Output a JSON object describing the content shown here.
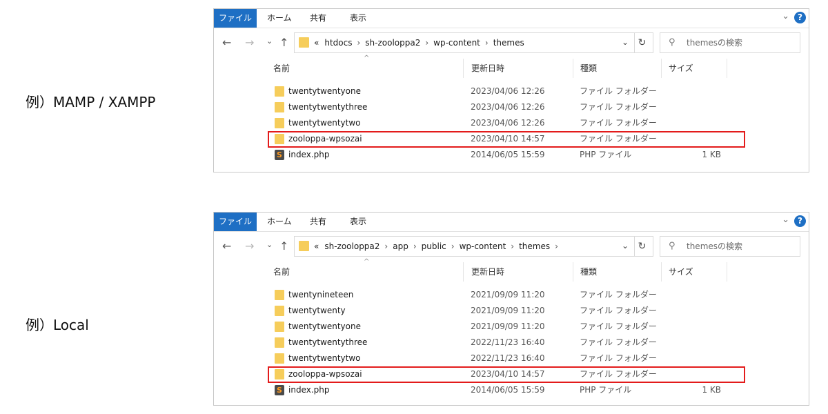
{
  "captions": [
    "例）MAMP / XAMPP",
    "例）Local"
  ],
  "ribbon_tabs": [
    "ファイル",
    "ホーム",
    "共有",
    "表示"
  ],
  "icons": {
    "back": "←",
    "forward": "→",
    "recent": "⌄",
    "up": "↑",
    "refresh": "↻",
    "search": "⚲",
    "dropdown": "⌄",
    "help": "?",
    "collapse": "⌄"
  },
  "columns": {
    "name": "名前",
    "date": "更新日時",
    "type": "種類",
    "size": "サイズ"
  },
  "search_placeholder": "themesの検索",
  "windows": [
    {
      "crumbs": [
        "«",
        "htdocs",
        "sh-zooloppa2",
        "wp-content",
        "themes"
      ],
      "rows": [
        {
          "name": "twentytwentyone",
          "date": "2023/04/06 12:26",
          "type": "ファイル フォルダー",
          "size": "",
          "icon": "folder"
        },
        {
          "name": "twentytwentythree",
          "date": "2023/04/06 12:26",
          "type": "ファイル フォルダー",
          "size": "",
          "icon": "folder"
        },
        {
          "name": "twentytwentytwo",
          "date": "2023/04/06 12:26",
          "type": "ファイル フォルダー",
          "size": "",
          "icon": "folder"
        },
        {
          "name": "zooloppa-wpsozai",
          "date": "2023/04/10 14:57",
          "type": "ファイル フォルダー",
          "size": "",
          "icon": "folder",
          "highlight": true
        },
        {
          "name": "index.php",
          "date": "2014/06/05 15:59",
          "type": "PHP ファイル",
          "size": "1 KB",
          "icon": "php"
        }
      ]
    },
    {
      "crumbs": [
        "«",
        "sh-zooloppa2",
        "app",
        "public",
        "wp-content",
        "themes",
        ""
      ],
      "rows": [
        {
          "name": "twentynineteen",
          "date": "2021/09/09 11:20",
          "type": "ファイル フォルダー",
          "size": "",
          "icon": "folder"
        },
        {
          "name": "twentytwenty",
          "date": "2021/09/09 11:20",
          "type": "ファイル フォルダー",
          "size": "",
          "icon": "folder"
        },
        {
          "name": "twentytwentyone",
          "date": "2021/09/09 11:20",
          "type": "ファイル フォルダー",
          "size": "",
          "icon": "folder"
        },
        {
          "name": "twentytwentythree",
          "date": "2022/11/23 16:40",
          "type": "ファイル フォルダー",
          "size": "",
          "icon": "folder"
        },
        {
          "name": "twentytwentytwo",
          "date": "2022/11/23 16:40",
          "type": "ファイル フォルダー",
          "size": "",
          "icon": "folder"
        },
        {
          "name": "zooloppa-wpsozai",
          "date": "2023/04/10 14:57",
          "type": "ファイル フォルダー",
          "size": "",
          "icon": "folder",
          "highlight": true
        },
        {
          "name": "index.php",
          "date": "2014/06/05 15:59",
          "type": "PHP ファイル",
          "size": "1 KB",
          "icon": "php"
        }
      ]
    }
  ],
  "colors": {
    "ribbon_file": "#1e6fc4",
    "folder": "#f6cd5b",
    "highlight": "#e31b1b"
  }
}
